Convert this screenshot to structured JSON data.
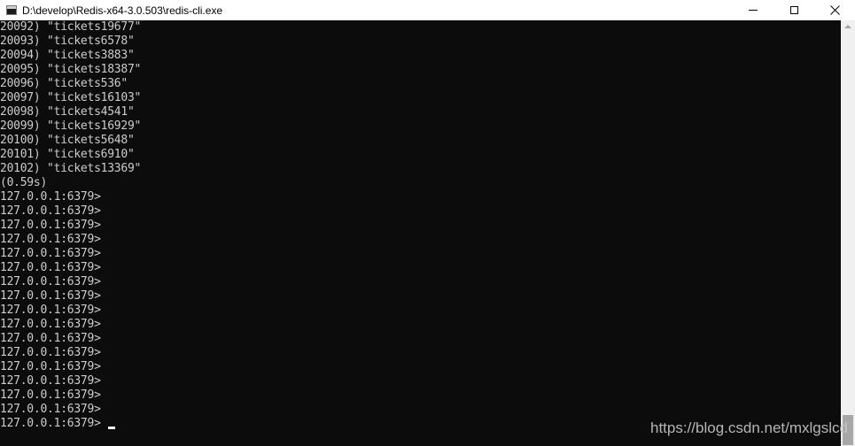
{
  "window": {
    "title": "D:\\develop\\Redis-x64-3.0.503\\redis-cli.exe",
    "icon": "console-icon",
    "controls": [
      "minimize-icon",
      "maximize-icon",
      "close-icon"
    ]
  },
  "console": {
    "lines": [
      "20092) \"tickets19677\"",
      "20093) \"tickets6578\"",
      "20094) \"tickets3883\"",
      "20095) \"tickets18387\"",
      "20096) \"tickets536\"",
      "20097) \"tickets16103\"",
      "20098) \"tickets4541\"",
      "20099) \"tickets16929\"",
      "20100) \"tickets5648\"",
      "20101) \"tickets6910\"",
      "20102) \"tickets13369\"",
      "(0.59s)",
      "127.0.0.1:6379>",
      "127.0.0.1:6379>",
      "127.0.0.1:6379>",
      "127.0.0.1:6379>",
      "127.0.0.1:6379>",
      "127.0.0.1:6379>",
      "127.0.0.1:6379>",
      "127.0.0.1:6379>",
      "127.0.0.1:6379>",
      "127.0.0.1:6379>",
      "127.0.0.1:6379>",
      "127.0.0.1:6379>",
      "127.0.0.1:6379>",
      "127.0.0.1:6379>",
      "127.0.0.1:6379>",
      "127.0.0.1:6379>",
      "127.0.0.1:6379>"
    ],
    "colors": {
      "background": "#0c0c0c",
      "foreground": "#cccccc"
    }
  },
  "watermark": "https://blog.csdn.net/mxlgslcd"
}
